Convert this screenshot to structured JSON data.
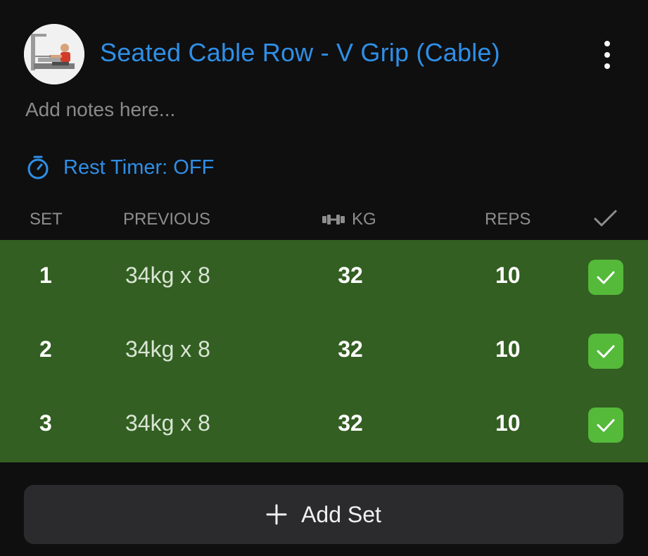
{
  "exercise": {
    "title": "Seated Cable Row - V Grip (Cable)",
    "notes_placeholder": "Add notes here...",
    "rest_timer_label": "Rest Timer: OFF"
  },
  "table": {
    "headers": {
      "set": "SET",
      "previous": "PREVIOUS",
      "kg": "KG",
      "reps": "REPS"
    },
    "rows": [
      {
        "set": "1",
        "previous": "34kg x 8",
        "kg": "32",
        "reps": "10",
        "completed": true
      },
      {
        "set": "2",
        "previous": "34kg x 8",
        "kg": "32",
        "reps": "10",
        "completed": true
      },
      {
        "set": "3",
        "previous": "34kg x 8",
        "kg": "32",
        "reps": "10",
        "completed": true
      }
    ]
  },
  "actions": {
    "add_set_label": "Add Set"
  },
  "colors": {
    "accent_blue": "#2f8fe6",
    "completed_row": "#335f22",
    "check_green": "#55b93a",
    "background": "#0f0f10",
    "button_bg": "#2b2b2e"
  },
  "icons": {
    "avatar": "exercise-thumbnail",
    "menu": "more-vertical-icon",
    "timer": "stopwatch-icon",
    "weight": "dumbbell-icon",
    "check_header": "checkmark-icon",
    "check": "checkmark-icon",
    "add": "plus-icon"
  }
}
